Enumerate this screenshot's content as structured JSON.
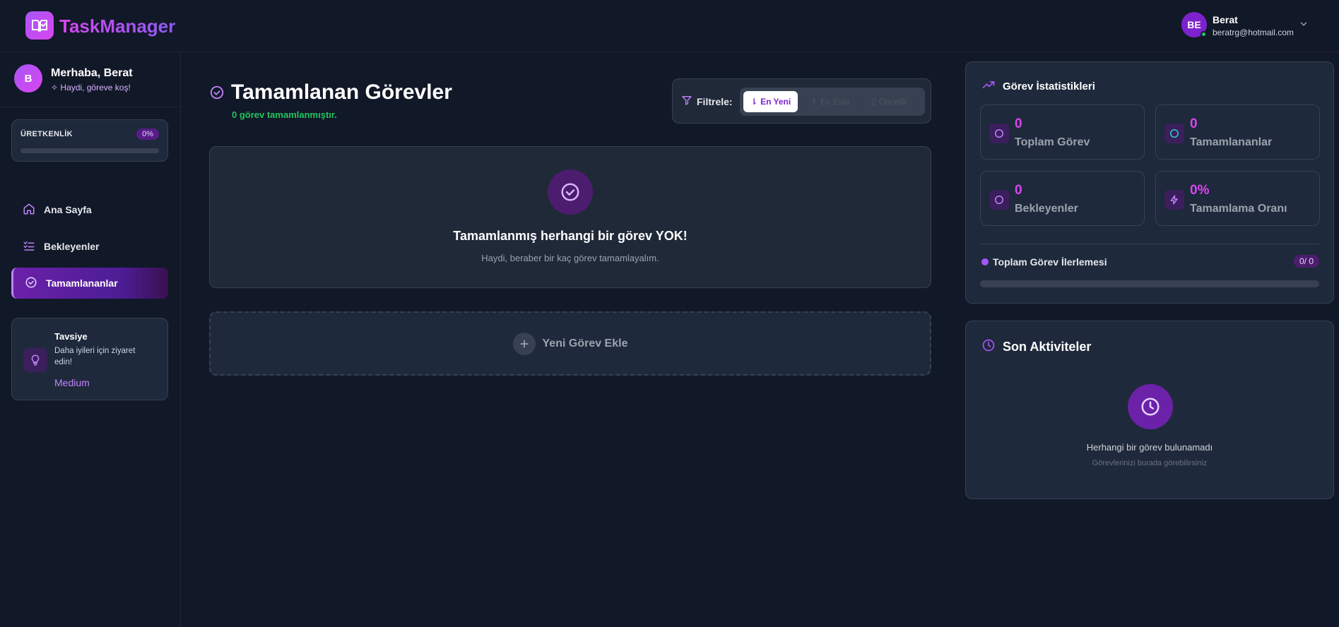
{
  "app": {
    "brand": "TaskManager"
  },
  "user": {
    "initials": "BE",
    "name": "Berat",
    "email": "beratrg@hotmail.com"
  },
  "sidebar": {
    "avatar_initial": "B",
    "greeting": "Merhaba, Berat",
    "motto": "Haydi, göreve koş!",
    "productivity": {
      "label": "ÜRETKENLİK",
      "percent_label": "0%",
      "value": 0
    },
    "nav": [
      {
        "label": "Ana Sayfa",
        "icon": "home-icon"
      },
      {
        "label": "Bekleyenler",
        "icon": "list-check-icon"
      },
      {
        "label": "Tamamlananlar",
        "icon": "check-circle-icon",
        "active": true
      }
    ],
    "tip": {
      "title": "Tavsiye",
      "text": "Daha iyileri için ziyaret edin!",
      "link": "Medium"
    }
  },
  "main": {
    "title": "Tamamlanan Görevler",
    "subtitle": "0 görev tamamlanmıştır.",
    "filter": {
      "label": "Filtrele:",
      "options": [
        {
          "label": "En Yeni",
          "active": true
        },
        {
          "label": "En Eski",
          "active": false
        },
        {
          "label": "Öncelik",
          "active": false
        }
      ]
    },
    "empty": {
      "title": "Tamamlanmış herhangi bir görev YOK!",
      "subtitle": "Haydi, beraber bir kaç görev tamamlayalım."
    },
    "add_task_label": "Yeni Görev Ekle"
  },
  "stats": {
    "title": "Görev İstatistikleri",
    "cards": [
      {
        "value": "0",
        "label": "Toplam Görev",
        "icon": "circle-icon"
      },
      {
        "value": "0",
        "label": "Tamamlananlar",
        "icon": "circle-icon"
      },
      {
        "value": "0",
        "label": "Bekleyenler",
        "icon": "circle-icon"
      },
      {
        "value": "0%",
        "label": "Tamamlama Oranı",
        "icon": "lightning-icon"
      }
    ],
    "progress": {
      "label": "Toplam Görev İlerlemesi",
      "badge": "0/ 0",
      "fraction": 0
    }
  },
  "activity": {
    "title": "Son Aktiviteler",
    "empty_title": "Herhangi bir görev bulunamadı",
    "empty_subtitle": "Görevlerinizi burada görebilirsiniz"
  },
  "colors": {
    "accent": "#a855f7",
    "accent2": "#d946ef",
    "success": "#22c55e",
    "bg": "#111827",
    "card": "#1e293b"
  }
}
